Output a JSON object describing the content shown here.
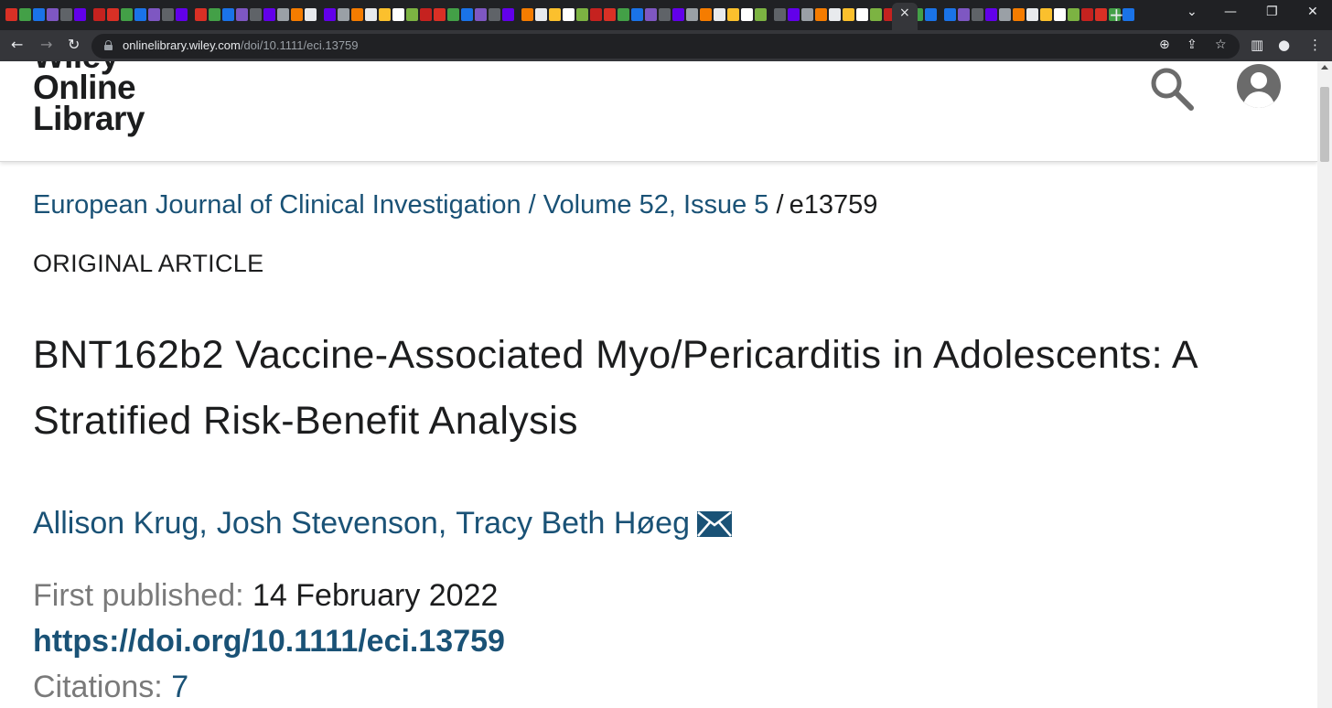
{
  "browser": {
    "url_host": "onlinelibrary.wiley.com",
    "url_path": "/doi/10.1111/eci.13759",
    "close_tab_glyph": "×",
    "new_tab_glyph": "+",
    "icons": [
      "back-icon",
      "forward-icon",
      "reload-icon",
      "lock-icon",
      "zoom-icon",
      "share-icon",
      "bookmark-star-icon",
      "side-panel-icon",
      "profile-icon",
      "menu-icon",
      "minimize-icon",
      "maximize-icon",
      "close-window-icon",
      "tab-search-icon"
    ]
  },
  "header": {
    "logo_lines": [
      "Wiley",
      "Online",
      "Library"
    ]
  },
  "breadcrumb": {
    "journal": "European Journal of Clinical Investigation",
    "separator": " / ",
    "volume": "Volume 52, Issue 5",
    "separator2": " /",
    "article_id": "e13759"
  },
  "article": {
    "type": "ORIGINAL ARTICLE",
    "title": "BNT162b2 Vaccine-Associated Myo/Pericarditis in Adolescents: A Stratified Risk-Benefit Analysis",
    "authors": [
      "Allison Krug",
      "Josh Stevenson",
      "Tracy Beth Høeg"
    ],
    "author_separator": ",",
    "first_published_label": "First published:",
    "first_published_date": "14 February 2022",
    "doi": "https://doi.org/10.1111/eci.13759",
    "citations_label": "Citations:",
    "citations_count": "7"
  },
  "colors": {
    "link": "#1a5276",
    "text": "#1c1d1e",
    "muted": "#7a7a7a",
    "chrome_dark": "#202124",
    "chrome_toolbar": "#35363a"
  }
}
